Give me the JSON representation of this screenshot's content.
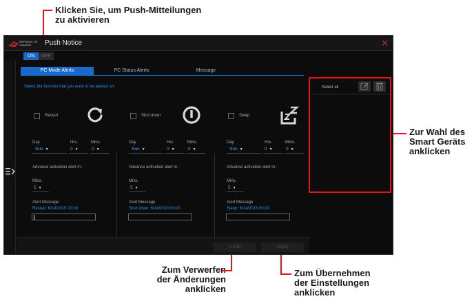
{
  "annotations": {
    "push_toggle": [
      "Klicken Sie, um Push-Mitteilungen",
      "zu aktivieren"
    ],
    "smart_device": [
      "Zur Wahl des",
      "Smart Geräts",
      "anklicken"
    ],
    "undo": [
      "Zum Verwerfen",
      "der Änderungen",
      "anklicken"
    ],
    "apply": [
      "Zum Übernehmen",
      "der Einstellungen",
      "anklicken"
    ]
  },
  "window": {
    "brand_line1": "REPUBLIC OF",
    "brand_line2": "GAMERS",
    "title": "Push Notice",
    "close_glyph": "✕"
  },
  "toggle": {
    "on": "ON",
    "off": "OFF"
  },
  "tabs": [
    "PC Mode Alerts",
    "PC Status Alerts",
    "Message"
  ],
  "prompt": "Select the function that you want to be alerted on.",
  "columns": [
    {
      "func": "Restart",
      "icon": "restart-icon",
      "day_label": "Day",
      "hrs_label": "Hrs.",
      "mins_label": "Mins.",
      "day": "Sun",
      "hrs": "0",
      "mins": "0",
      "advance_label": "Advance activation alert in :",
      "adv_mins_label": "Mins.",
      "adv_mins": "5",
      "msg_label": "Alert Message",
      "msg_value": "Restart: 6/14/2015 00:00"
    },
    {
      "func": "Shut down",
      "icon": "power-icon",
      "day_label": "Day",
      "hrs_label": "Hrs.",
      "mins_label": "Mins.",
      "day": "Sun",
      "hrs": "0",
      "mins": "0",
      "advance_label": "Advance activation alert in :",
      "adv_mins_label": "Mins.",
      "adv_mins": "5",
      "msg_label": "Alert Message",
      "msg_value": "Shut down: 6/14/2015 00:00"
    },
    {
      "func": "Sleep",
      "icon": "sleep-icon",
      "day_label": "Day",
      "hrs_label": "Hrs.",
      "mins_label": "Mins.",
      "day": "Sun",
      "hrs": "0",
      "mins": "0",
      "advance_label": "Advance activation alert in :",
      "adv_mins_label": "Mins.",
      "adv_mins": "5",
      "msg_label": "Alert Message",
      "msg_value": "Sleep: 6/14/2015 00:00"
    }
  ],
  "dropdown_glyph": "▼",
  "footer": {
    "undo": "Undo",
    "apply": "Apply"
  },
  "right_panel": {
    "select_all": "Select all"
  },
  "colors": {
    "accent": "#1a6acb",
    "link": "#2b8cff",
    "callout_red": "#e3121b"
  }
}
